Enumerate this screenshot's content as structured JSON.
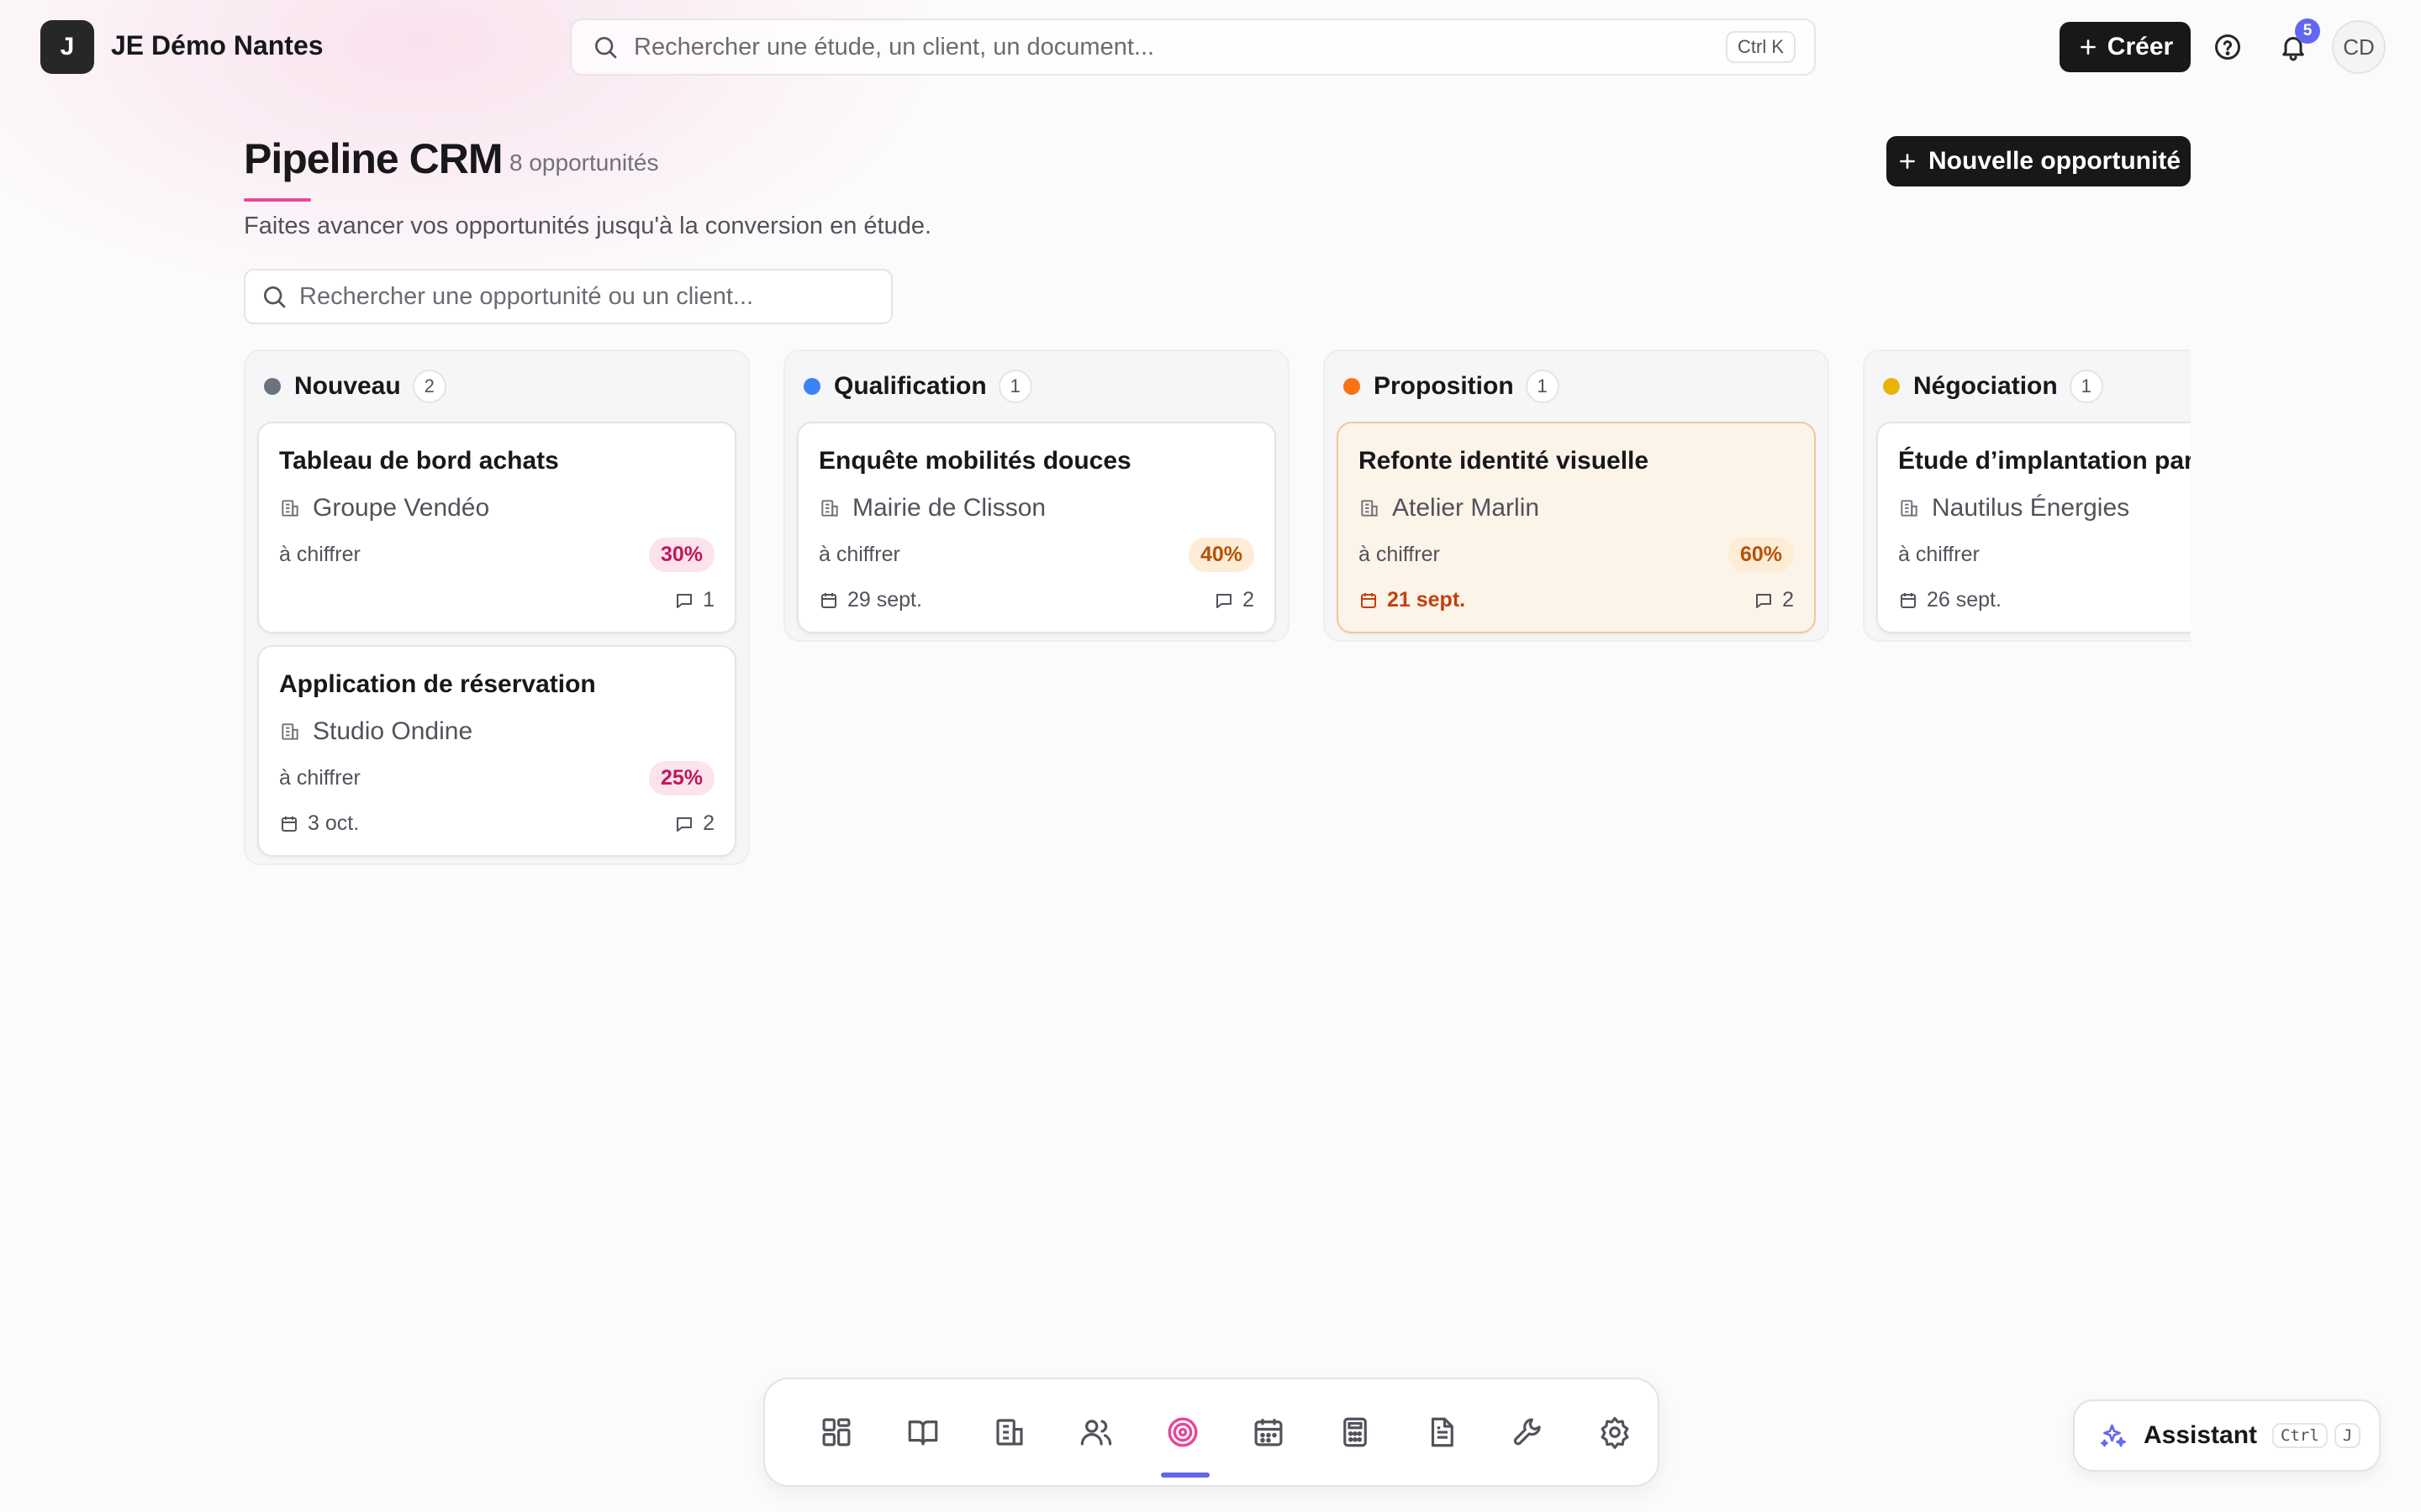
{
  "app": {
    "logo_letter": "J",
    "title": "JE Démo Nantes"
  },
  "global_search": {
    "placeholder": "Rechercher une étude, un client, un document...",
    "shortcut": "Ctrl K"
  },
  "topbar": {
    "create_label": "Créer",
    "notification_count": "5",
    "avatar_initials": "CD"
  },
  "header": {
    "title": "Pipeline CRM",
    "count": "8 opportunités",
    "subtitle": "Faites avancer vos opportunités jusqu'à la conversion en étude.",
    "new_button_label": "Nouvelle opportunité"
  },
  "opp_search": {
    "placeholder": "Rechercher une opportunité ou un client..."
  },
  "columns": [
    {
      "name": "Nouveau",
      "count": "2",
      "color": "#6b7280",
      "cards": [
        {
          "title": "Tableau de bord achats",
          "client": "Groupe Vendéo",
          "status": "à chiffrer",
          "probability": "30%",
          "date": "",
          "comments": "1"
        },
        {
          "title": "Application de réservation",
          "client": "Studio Ondine",
          "status": "à chiffrer",
          "probability": "25%",
          "date": "3 oct.",
          "comments": "2"
        }
      ]
    },
    {
      "name": "Qualification",
      "count": "1",
      "color": "#3b82f6",
      "cards": [
        {
          "title": "Enquête mobilités douces",
          "client": "Mairie de Clisson",
          "status": "à chiffrer",
          "probability": "40%",
          "date": "29 sept.",
          "comments": "2"
        }
      ]
    },
    {
      "name": "Proposition",
      "count": "1",
      "color": "#f97316",
      "cards": [
        {
          "title": "Refonte identité visuelle",
          "client": "Atelier Marlin",
          "status": "à chiffrer",
          "probability": "60%",
          "date": "21 sept.",
          "comments": "2"
        }
      ]
    },
    {
      "name": "Négociation",
      "count": "1",
      "color": "#eab308",
      "cards": [
        {
          "title": "Étude d’implantation parc solaire",
          "client": "Nautilus Énergies",
          "status": "à chiffrer",
          "probability": "",
          "date": "26 sept.",
          "comments": ""
        }
      ]
    }
  ],
  "dock": {
    "items": [
      "dashboard-icon",
      "book-icon",
      "building-icon",
      "users-icon",
      "target-icon",
      "calendar-icon",
      "calculator-icon",
      "document-icon",
      "wrench-icon",
      "settings-icon"
    ],
    "active": "target-icon",
    "active_color": "#e6499a"
  },
  "assistant": {
    "label": "Assistant",
    "key1": "Ctrl",
    "key2": "J"
  }
}
